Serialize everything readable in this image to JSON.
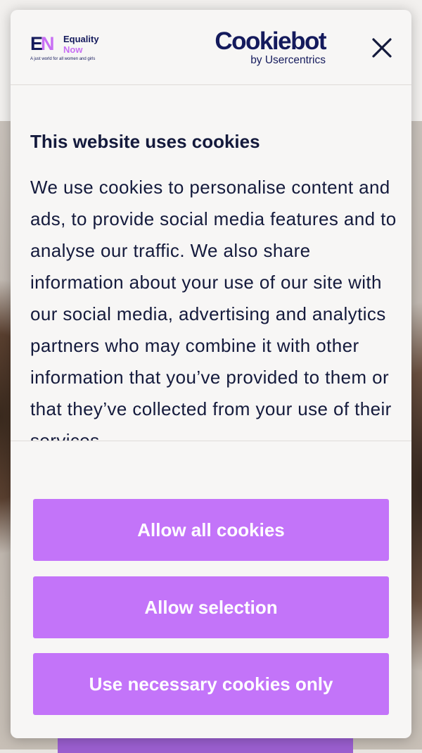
{
  "brand": {
    "site_logo_mark_e": "E",
    "site_logo_mark_n": "N",
    "site_name_line1": "Equality",
    "site_name_line2": "Now",
    "site_tagline": "A just world for all women and girls",
    "cmp_name": "Cookiebot",
    "cmp_by": "by Usercentrics"
  },
  "dialog": {
    "title": "This website uses cookies",
    "body": "We use cookies to personalise content and ads, to provide social media features and to analyse our traffic. We also share information about your use of our site with our social media, advertising and analytics partners who may combine it with other information that you’ve provided to them or that they’ve collected from your use of their services.",
    "close_icon": "close-icon"
  },
  "buttons": {
    "allow_all": "Allow all cookies",
    "allow_selection": "Allow selection",
    "necessary_only": "Use necessary cookies only"
  },
  "colors": {
    "button_bg": "#c374f9",
    "text_primary": "#141a3c",
    "brand_navy": "#141a5c",
    "brand_purple": "#c86ff4"
  }
}
